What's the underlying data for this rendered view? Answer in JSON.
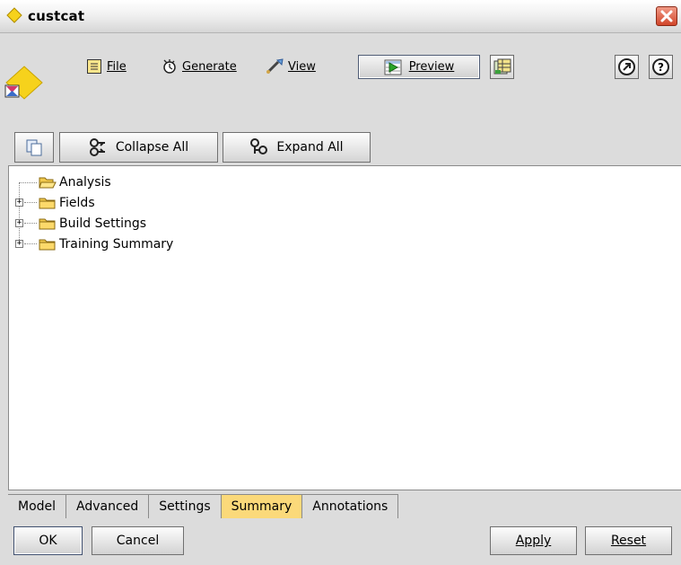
{
  "window": {
    "title": "custcat",
    "icons": {
      "title": "diamond-icon",
      "close": "close-icon",
      "node": "model-node-icon"
    }
  },
  "toolbar": {
    "file_label": "File",
    "generate_label": "Generate",
    "view_label": "View",
    "preview_label": "Preview"
  },
  "actions": {
    "collapse_all_label": "Collapse All",
    "expand_all_label": "Expand All"
  },
  "tree": {
    "items": [
      {
        "label": "Analysis",
        "expandable": false,
        "open": true
      },
      {
        "label": "Fields",
        "expandable": true,
        "open": false
      },
      {
        "label": "Build Settings",
        "expandable": true,
        "open": false
      },
      {
        "label": "Training Summary",
        "expandable": true,
        "open": false
      }
    ]
  },
  "tabs": {
    "items": [
      "Model",
      "Advanced",
      "Settings",
      "Summary",
      "Annotations"
    ],
    "active": "Summary"
  },
  "buttons": {
    "ok_label": "OK",
    "cancel_label": "Cancel",
    "apply_label": "Apply",
    "reset_label": "Reset"
  },
  "colors": {
    "active_tab": "#fbd97a",
    "close_button": "#d1452a",
    "diamond": "#f6d21c"
  }
}
